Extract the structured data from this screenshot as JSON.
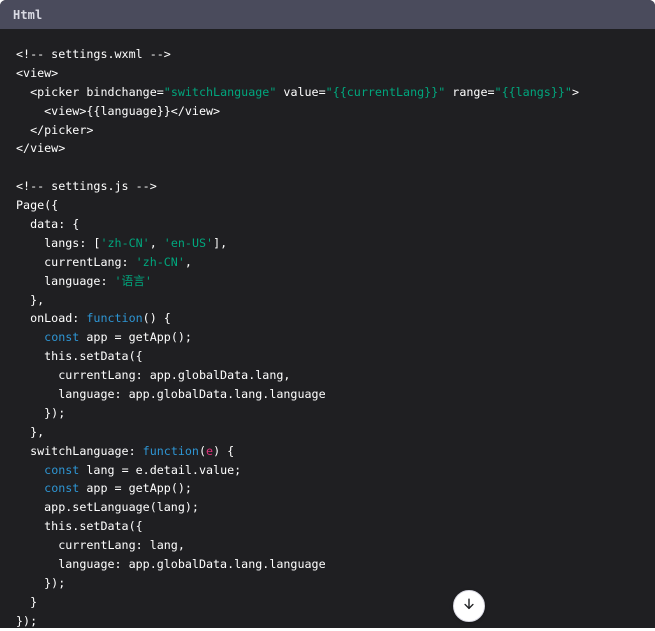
{
  "header": {
    "language_label": "Html"
  },
  "code_lines": [
    [
      {
        "t": "<!-- settings.wxml -->",
        "c": "comment"
      }
    ],
    [
      {
        "t": "<view>",
        "c": "plain"
      }
    ],
    [
      {
        "t": "  <picker bindchange=",
        "c": "plain"
      },
      {
        "t": "\"switchLanguage\"",
        "c": "string"
      },
      {
        "t": " value=",
        "c": "plain"
      },
      {
        "t": "\"{{currentLang}}\"",
        "c": "string"
      },
      {
        "t": " range=",
        "c": "plain"
      },
      {
        "t": "\"{{langs}}\"",
        "c": "string"
      },
      {
        "t": ">",
        "c": "plain"
      }
    ],
    [
      {
        "t": "    <view>{{language}}</view>",
        "c": "plain"
      }
    ],
    [
      {
        "t": "  </picker>",
        "c": "plain"
      }
    ],
    [
      {
        "t": "</view>",
        "c": "plain"
      }
    ],
    [
      {
        "t": "",
        "c": "plain"
      }
    ],
    [
      {
        "t": "<!-- settings.js -->",
        "c": "comment"
      }
    ],
    [
      {
        "t": "Page({",
        "c": "plain"
      }
    ],
    [
      {
        "t": "  data: {",
        "c": "plain"
      }
    ],
    [
      {
        "t": "    langs: [",
        "c": "plain"
      },
      {
        "t": "'zh-CN'",
        "c": "string"
      },
      {
        "t": ", ",
        "c": "plain"
      },
      {
        "t": "'en-US'",
        "c": "string"
      },
      {
        "t": "],",
        "c": "plain"
      }
    ],
    [
      {
        "t": "    currentLang: ",
        "c": "plain"
      },
      {
        "t": "'zh-CN'",
        "c": "string"
      },
      {
        "t": ",",
        "c": "plain"
      }
    ],
    [
      {
        "t": "    language: ",
        "c": "plain"
      },
      {
        "t": "'语言'",
        "c": "string"
      }
    ],
    [
      {
        "t": "  },",
        "c": "plain"
      }
    ],
    [
      {
        "t": "  onLoad: ",
        "c": "plain"
      },
      {
        "t": "function",
        "c": "keyword"
      },
      {
        "t": "() {",
        "c": "plain"
      }
    ],
    [
      {
        "t": "    ",
        "c": "plain"
      },
      {
        "t": "const",
        "c": "keyword"
      },
      {
        "t": " app = getApp();",
        "c": "plain"
      }
    ],
    [
      {
        "t": "    this.setData({",
        "c": "plain"
      }
    ],
    [
      {
        "t": "      currentLang: app.globalData.lang,",
        "c": "plain"
      }
    ],
    [
      {
        "t": "      language: app.globalData.lang.language",
        "c": "plain"
      }
    ],
    [
      {
        "t": "    });",
        "c": "plain"
      }
    ],
    [
      {
        "t": "  },",
        "c": "plain"
      }
    ],
    [
      {
        "t": "  switchLanguage: ",
        "c": "plain"
      },
      {
        "t": "function",
        "c": "keyword"
      },
      {
        "t": "(",
        "c": "plain"
      },
      {
        "t": "e",
        "c": "param"
      },
      {
        "t": ") {",
        "c": "plain"
      }
    ],
    [
      {
        "t": "    ",
        "c": "plain"
      },
      {
        "t": "const",
        "c": "keyword"
      },
      {
        "t": " lang = e.detail.value;",
        "c": "plain"
      }
    ],
    [
      {
        "t": "    ",
        "c": "plain"
      },
      {
        "t": "const",
        "c": "keyword"
      },
      {
        "t": " app = getApp();",
        "c": "plain"
      }
    ],
    [
      {
        "t": "    app.setLanguage(lang);",
        "c": "plain"
      }
    ],
    [
      {
        "t": "    this.setData({",
        "c": "plain"
      }
    ],
    [
      {
        "t": "      currentLang: lang,",
        "c": "plain"
      }
    ],
    [
      {
        "t": "      language: app.globalData.lang.language",
        "c": "plain"
      }
    ],
    [
      {
        "t": "    });",
        "c": "plain"
      }
    ],
    [
      {
        "t": "  }",
        "c": "plain"
      }
    ],
    [
      {
        "t": "});",
        "c": "plain"
      }
    ]
  ],
  "scroll_button": {
    "icon": "arrow-down-icon"
  },
  "colors": {
    "header_bg": "#4a4b5c",
    "code_bg": "#1f1f22",
    "string": "#00a67d",
    "keyword": "#2e95d3",
    "param": "#df3079"
  }
}
